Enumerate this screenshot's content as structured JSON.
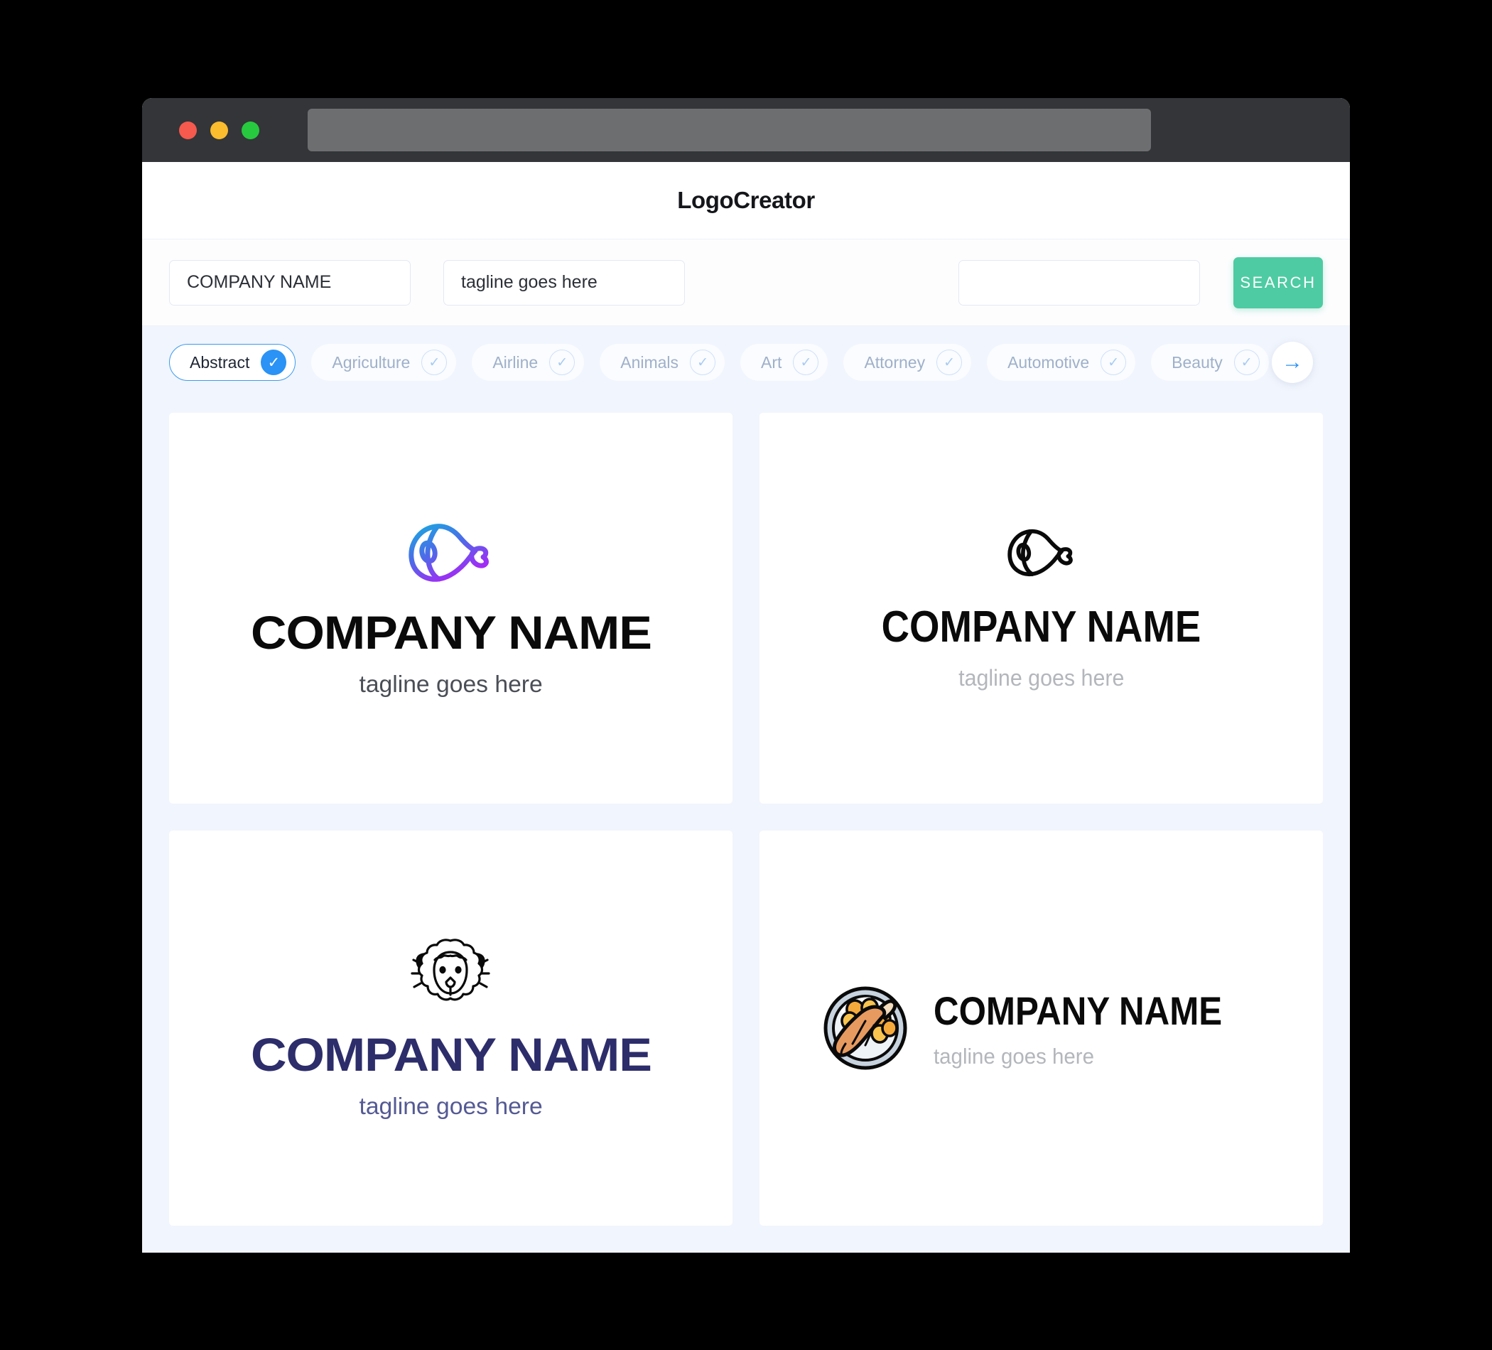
{
  "window": {
    "traffic_lights": [
      "close",
      "minimize",
      "maximize"
    ],
    "url_value": ""
  },
  "header": {
    "title": "LogoCreator"
  },
  "search": {
    "company_name_value": "COMPANY NAME",
    "company_name_placeholder": "COMPANY NAME",
    "tagline_value": "tagline goes here",
    "tagline_placeholder": "tagline goes here",
    "keyword_value": "",
    "keyword_placeholder": "",
    "search_button_label": "SEARCH"
  },
  "categories": {
    "items": [
      {
        "label": "Abstract",
        "selected": true
      },
      {
        "label": "Agriculture",
        "selected": false
      },
      {
        "label": "Airline",
        "selected": false
      },
      {
        "label": "Animals",
        "selected": false
      },
      {
        "label": "Art",
        "selected": false
      },
      {
        "label": "Attorney",
        "selected": false
      },
      {
        "label": "Automotive",
        "selected": false
      },
      {
        "label": "Beauty",
        "selected": false
      }
    ],
    "next_arrow": "→",
    "check_glyph": "✓"
  },
  "results": {
    "cards": [
      {
        "icon_name": "ham-leg-icon",
        "icon_style": "gradient-outline",
        "layout": "stacked",
        "name": "COMPANY NAME",
        "tagline": "tagline goes here",
        "name_color": "#0a0a0a",
        "tagline_color": "#4a4e56"
      },
      {
        "icon_name": "ham-leg-icon",
        "icon_style": "black-outline",
        "layout": "stacked",
        "name": "COMPANY NAME",
        "tagline": "tagline goes here",
        "name_color": "#0a0a0a",
        "tagline_color": "#b3b6bb"
      },
      {
        "icon_name": "sheep-head-icon",
        "icon_style": "black-outline",
        "layout": "stacked",
        "name": "COMPANY NAME",
        "tagline": "tagline goes here",
        "name_color": "#2d2d6b",
        "tagline_color": "#555a94"
      },
      {
        "icon_name": "roast-chicken-plate-icon",
        "icon_style": "color-filled",
        "layout": "horizontal",
        "name": "COMPANY NAME",
        "tagline": "tagline goes here",
        "name_color": "#0a0a0a",
        "tagline_color": "#b3b6bb"
      }
    ]
  },
  "colors": {
    "accent_green": "#4ecba2",
    "accent_blue": "#2a93f5",
    "page_bg": "#f1f5fd",
    "titlebar": "#333538",
    "gradient_start": "#1aa7e0",
    "gradient_end": "#a22bf5",
    "logo_navy": "#2d2d6b",
    "chicken_orange": "#e79a5f"
  }
}
